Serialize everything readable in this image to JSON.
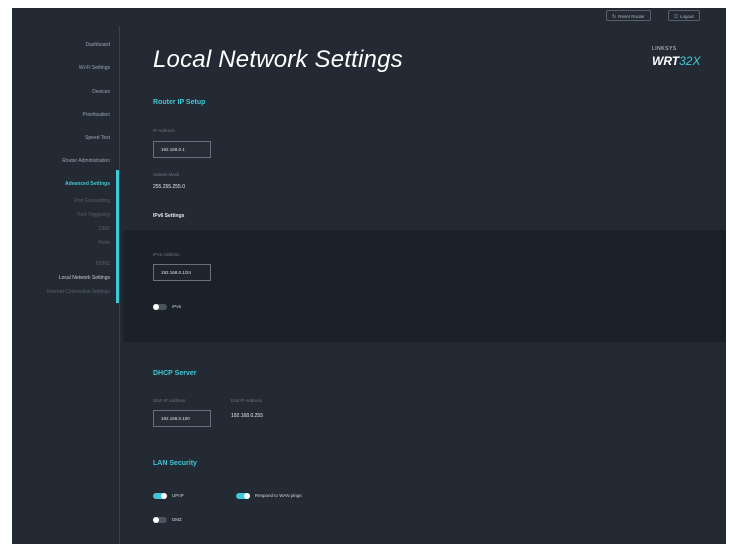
{
  "topbar": {
    "reset_label": "Reset Router",
    "logout_label": "Logout"
  },
  "sidebar": {
    "items": [
      {
        "label": "Dashboard"
      },
      {
        "label": "Wi-Fi Settings"
      },
      {
        "label": "Devices"
      },
      {
        "label": "Prioritization"
      },
      {
        "label": "Speed Test"
      },
      {
        "label": "Router Administration"
      },
      {
        "label": "Advanced Settings"
      },
      {
        "label": "Port Forwarding"
      },
      {
        "label": "Port Triggering"
      },
      {
        "label": "DMZ"
      },
      {
        "label": "Ports"
      },
      {
        "label": "DDNS"
      },
      {
        "label": "Local Network Settings"
      },
      {
        "label": "Internet Connection Settings"
      }
    ]
  },
  "page": {
    "title": "Local Network Settings"
  },
  "brand": {
    "maker": "LINKSYS",
    "model_prefix": "WRT",
    "model_number": "32X"
  },
  "router_ip_setup": {
    "heading": "Router IP Setup",
    "ip_label": "IP Address",
    "ip_value": "192.168.0.1",
    "subnet_label": "Subnet Mask",
    "subnet_value": "255.255.255.0",
    "ipv6_heading": "IPv6 Settings",
    "ipv6_label": "IPv6 Address",
    "ipv6_value": "192.168.0.1/24",
    "ipv6_toggle_label": "IPv6"
  },
  "dhcp_server": {
    "heading": "DHCP Server",
    "start_label": "Start IP Address",
    "start_value": "192.168.0.100",
    "end_label": "End IP Address",
    "end_value": "192.168.0.255"
  },
  "lan_security": {
    "heading": "LAN Security",
    "upnp_label": "UPnP",
    "wan_ping_label": "Respond to WAN pings",
    "dmz_label": "DMZ"
  }
}
